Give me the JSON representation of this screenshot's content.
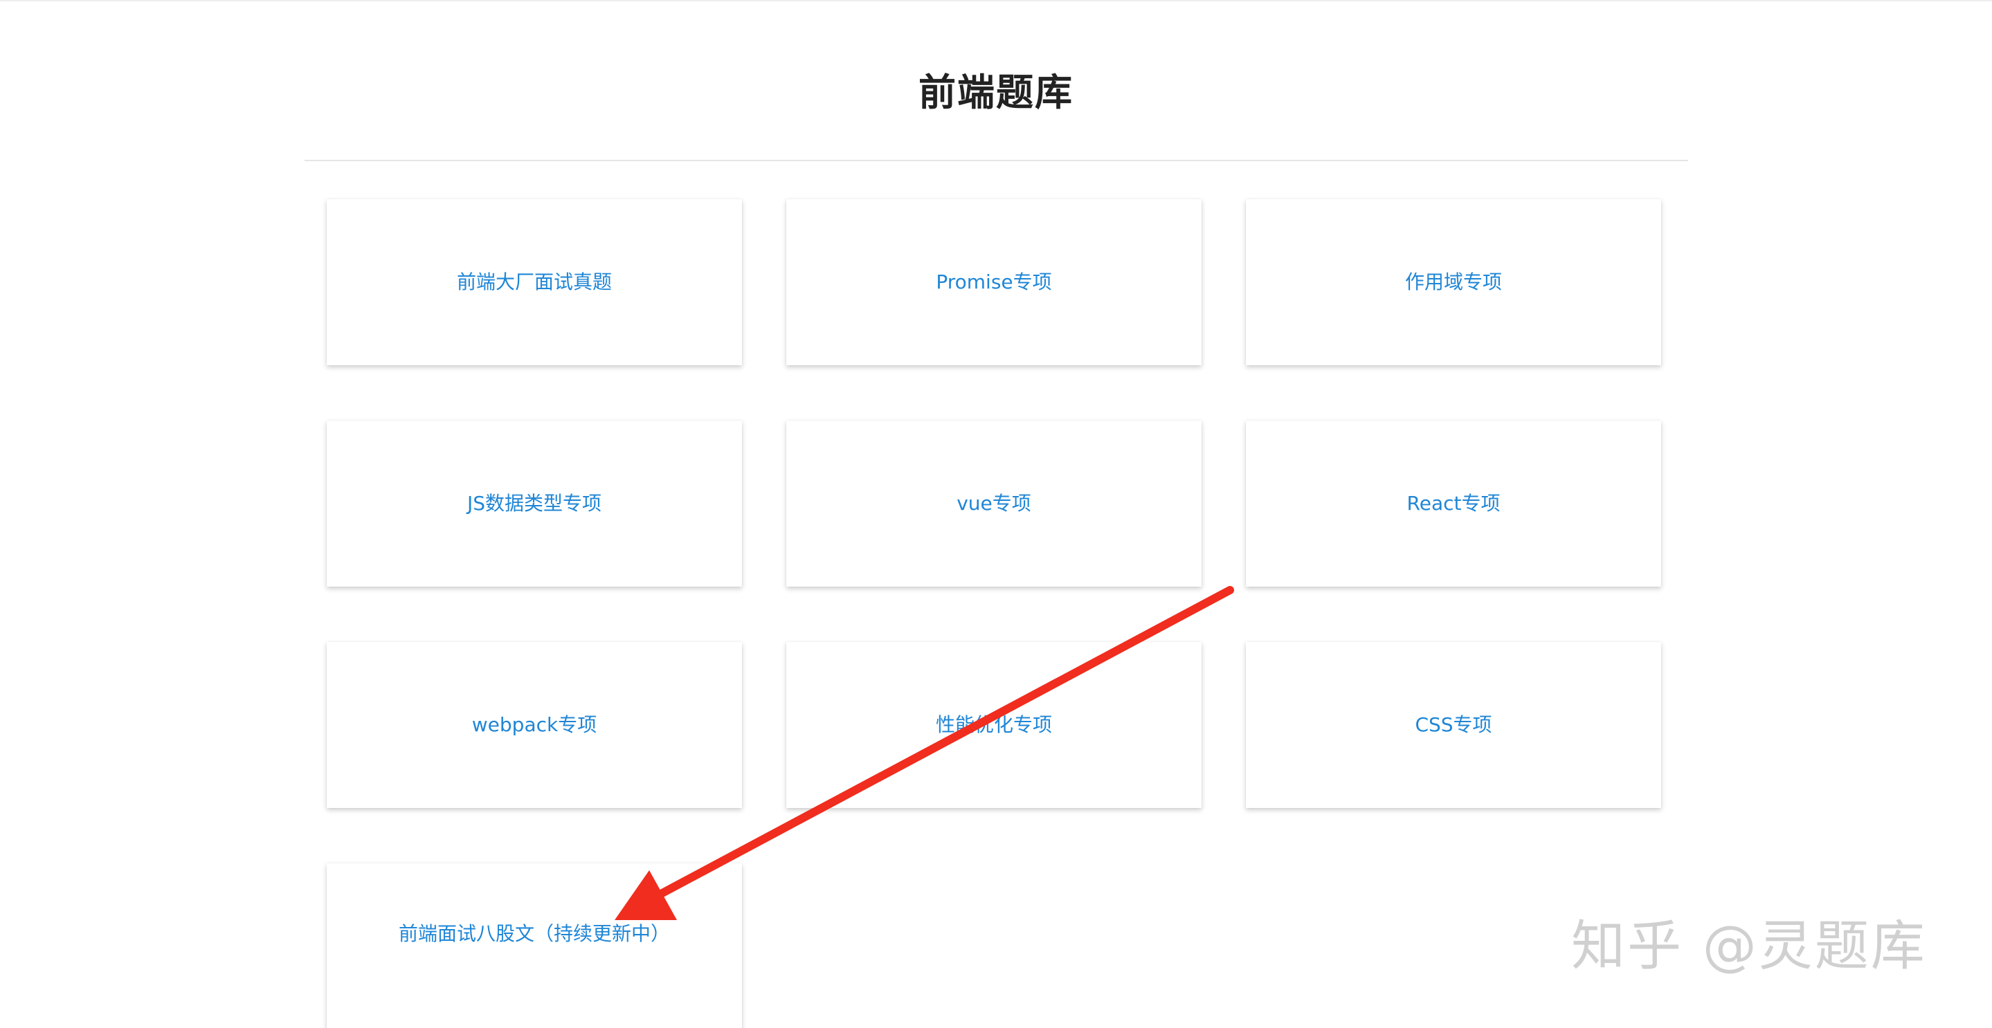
{
  "page": {
    "title": "前端题库"
  },
  "cards": [
    {
      "label": "前端大厂面试真题"
    },
    {
      "label": "Promise专项"
    },
    {
      "label": "作用域专项"
    },
    {
      "label": "JS数据类型专项"
    },
    {
      "label": "vue专项"
    },
    {
      "label": "React专项"
    },
    {
      "label": "webpack专项"
    },
    {
      "label": "性能优化专项"
    },
    {
      "label": "CSS专项"
    },
    {
      "label": "前端面试八股文（持续更新中）"
    }
  ],
  "watermark": {
    "text": "知乎 @灵题库"
  },
  "colors": {
    "link": "#1f86d6",
    "title": "#222222",
    "arrow": "#f02d1e"
  }
}
